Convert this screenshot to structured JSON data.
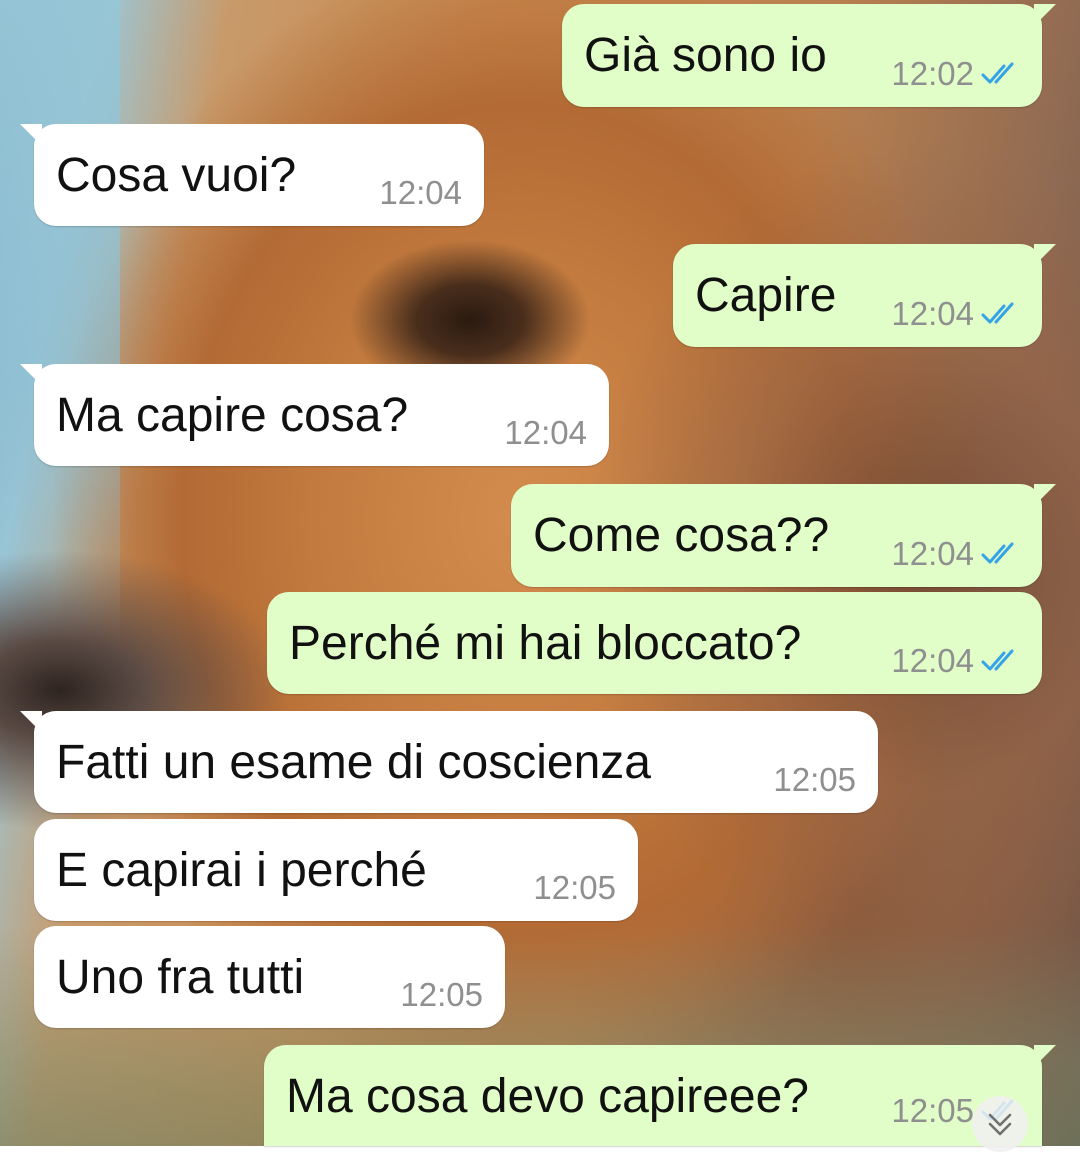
{
  "messages": [
    {
      "id": "m1",
      "direction": "out",
      "text": "Già sono io",
      "time": "12:02",
      "read": true
    },
    {
      "id": "m2",
      "direction": "in",
      "text": "Cosa vuoi?",
      "time": "12:04"
    },
    {
      "id": "m3",
      "direction": "out",
      "text": "Capire",
      "time": "12:04",
      "read": true
    },
    {
      "id": "m4",
      "direction": "in",
      "text": "Ma capire cosa?",
      "time": "12:04"
    },
    {
      "id": "m5",
      "direction": "out",
      "text": "Come cosa??",
      "time": "12:04",
      "read": true
    },
    {
      "id": "m6",
      "direction": "out",
      "text": "Perché mi hai bloccato?",
      "time": "12:04",
      "read": true
    },
    {
      "id": "m7",
      "direction": "in",
      "text": "Fatti un esame di coscienza",
      "time": "12:05"
    },
    {
      "id": "m8",
      "direction": "in",
      "text": "E capirai i perché",
      "time": "12:05"
    },
    {
      "id": "m9",
      "direction": "in",
      "text": "Uno fra tutti",
      "time": "12:05"
    },
    {
      "id": "m10",
      "direction": "out",
      "text": "Ma cosa devo capireee?",
      "time": "12:05",
      "read": true
    }
  ],
  "colors": {
    "incoming_bubble": "#ffffff",
    "outgoing_bubble": "#e2fec8",
    "read_ticks": "#34a3e8",
    "timestamp": "#8f8f8f"
  },
  "icons": {
    "read_receipt": "double-check-icon",
    "scroll_down": "chevron-double-down-icon"
  }
}
